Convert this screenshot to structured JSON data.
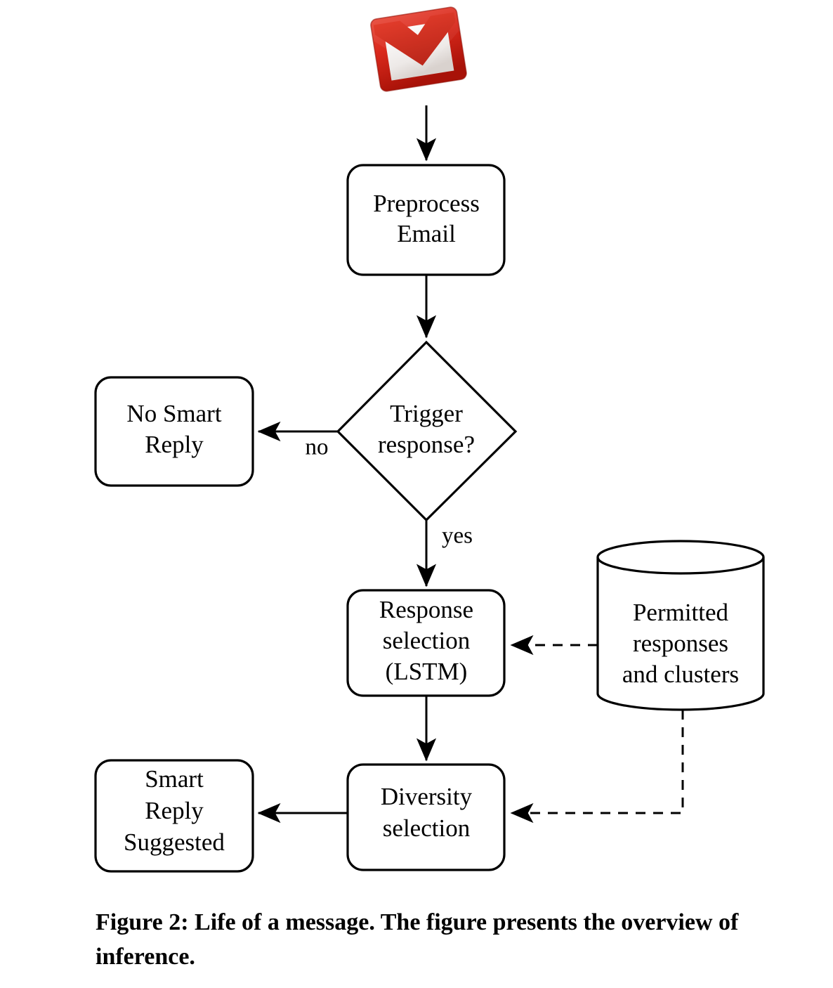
{
  "figure": {
    "caption": "Figure 2: Life of a message. The figure presents the overview of inference."
  },
  "nodes": {
    "gmail_icon": {
      "name": "gmail-logo",
      "label": ""
    },
    "preprocess": {
      "line1": "Preprocess",
      "line2": "Email"
    },
    "trigger": {
      "line1": "Trigger",
      "line2": "response?"
    },
    "no_smart_reply": {
      "line1": "No Smart",
      "line2": "Reply"
    },
    "response_selection": {
      "line1": "Response",
      "line2": "selection",
      "line3": "(LSTM)"
    },
    "permitted": {
      "line1": "Permitted",
      "line2": "responses",
      "line3": "and clusters"
    },
    "diversity": {
      "line1": "Diversity",
      "line2": "selection"
    },
    "smart_reply": {
      "line1": "Smart",
      "line2": "Reply",
      "line3": "Suggested"
    }
  },
  "edges": {
    "no_label": "no",
    "yes_label": "yes"
  },
  "colors": {
    "no_smart_reply_fill": "#FFCCC8",
    "smart_reply_fill": "#CCFFCC",
    "node_fill": "#FFFFFF",
    "stroke": "#000000",
    "gmail_red_dark": "#A81208",
    "gmail_red": "#D9291C",
    "gmail_red_light": "#E8493A",
    "gmail_envelope": "#F5F3F1"
  }
}
